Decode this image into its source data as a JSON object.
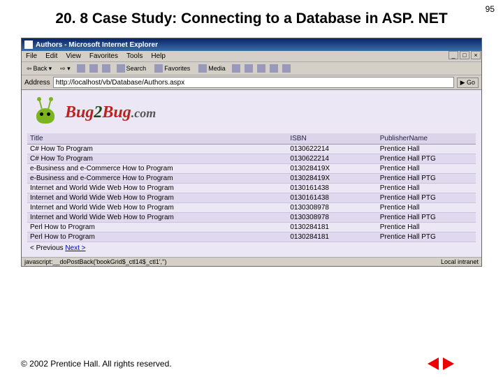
{
  "page_number": "95",
  "slide_title": "20. 8 Case Study: Connecting to a Database in ASP. NET",
  "browser": {
    "title": "Authors - Microsoft Internet Explorer",
    "menus": [
      "File",
      "Edit",
      "View",
      "Favorites",
      "Tools",
      "Help"
    ],
    "toolbar": {
      "back": "Back",
      "search": "Search",
      "favorites": "Favorites",
      "media": "Media"
    },
    "address_label": "Address",
    "url": "http://localhost/vb/Database/Authors.aspx",
    "go": "Go"
  },
  "logo": {
    "brand_b": "Bug",
    "brand_n": "2",
    "brand_b2": "Bug",
    "brand_c": ".com"
  },
  "table": {
    "headers": [
      "Title",
      "ISBN",
      "PublisherName"
    ],
    "rows": [
      [
        "C# How To Program",
        "0130622214",
        "Prentice Hall"
      ],
      [
        "C# How To Program",
        "0130622214",
        "Prentice Hall PTG"
      ],
      [
        "e-Business and e-Commerce How to Program",
        "013028419X",
        "Prentice Hall"
      ],
      [
        "e-Business and e-Commerce How to Program",
        "013028419X",
        "Prentice Hall PTG"
      ],
      [
        "Internet and World Wide Web How to Program",
        "0130161438",
        "Prentice Hall"
      ],
      [
        "Internet and World Wide Web How to Program",
        "0130161438",
        "Prentice Hall PTG"
      ],
      [
        "Internet and World Wide Web How to Program",
        "0130308978",
        "Prentice Hall"
      ],
      [
        "Internet and World Wide Web How to Program",
        "0130308978",
        "Prentice Hall PTG"
      ],
      [
        "Perl How to Program",
        "0130284181",
        "Prentice Hall"
      ],
      [
        "Perl How to Program",
        "0130284181",
        "Prentice Hall PTG"
      ]
    ]
  },
  "pager": {
    "prev": "< Previous",
    "next": "Next >"
  },
  "status": {
    "left": "javascript:__doPostBack('bookGrid$_ctl14$_ctl1','')",
    "right": "Local intranet"
  },
  "footer": "© 2002 Prentice Hall.  All rights reserved."
}
